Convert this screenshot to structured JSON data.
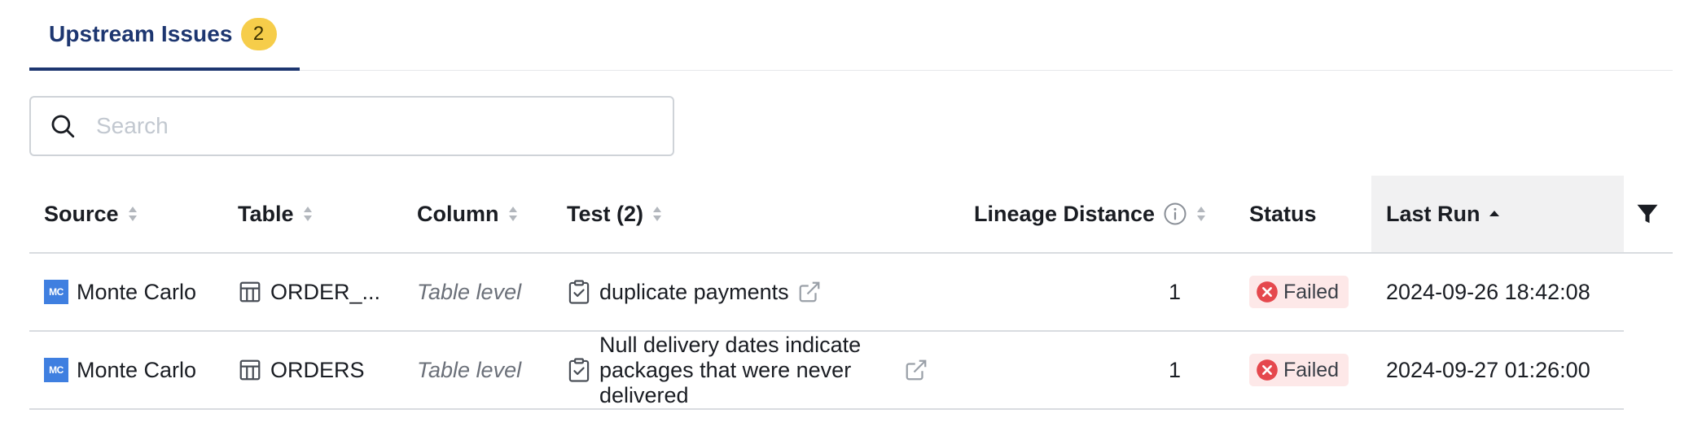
{
  "tabs": [
    {
      "label": "Upstream Issues",
      "count": "2"
    }
  ],
  "search": {
    "placeholder": "Search"
  },
  "table": {
    "headers": {
      "source": "Source",
      "table": "Table",
      "column": "Column",
      "test": "Test (2)",
      "lineage": "Lineage Distance",
      "status": "Status",
      "last_run": "Last Run"
    },
    "sort": {
      "column": "Last Run",
      "direction": "ascending"
    },
    "rows": [
      {
        "source": "Monte Carlo",
        "source_logo": "MC",
        "table": "ORDER_...",
        "column": "Table level",
        "test": "duplicate payments",
        "lineage": "1",
        "status": "Failed",
        "last_run": "2024-09-26 18:42:08"
      },
      {
        "source": "Monte Carlo",
        "source_logo": "MC",
        "table": "ORDERS",
        "column": "Table level",
        "test": "Null delivery dates indicate packages that were never delivered",
        "lineage": "1",
        "status": "Failed",
        "last_run": "2024-09-27 01:26:00"
      }
    ]
  },
  "icons": {
    "search": "search-icon",
    "sort": "sort-icon",
    "sort_asc": "sort-ascending-icon",
    "info": "info-icon",
    "filter": "filter-icon",
    "table": "table-icon",
    "test": "clipboard-check-icon",
    "external": "external-link-icon",
    "failed": "error-circle-icon"
  },
  "colors": {
    "accent": "#1d3670",
    "badge": "#f6cd4a",
    "failed_bg": "#fde8e8",
    "failed_icon": "#e5484d",
    "logo": "#3f7fe0"
  }
}
